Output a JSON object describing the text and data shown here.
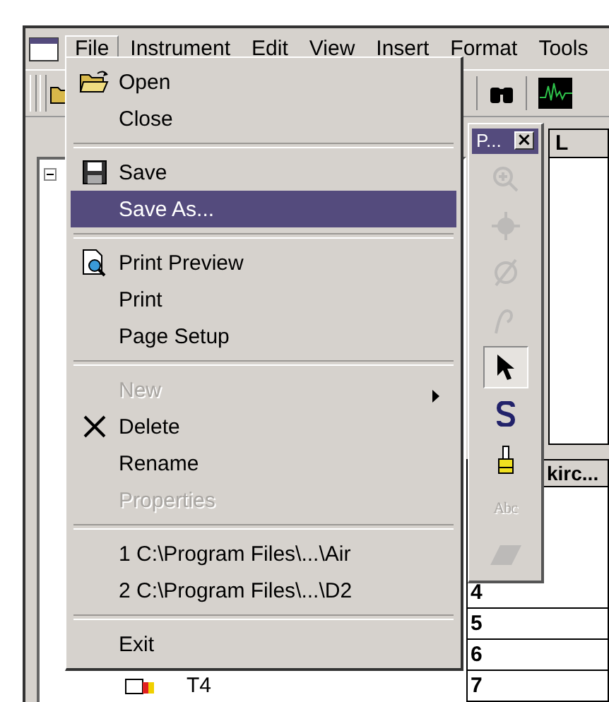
{
  "menu_bar": [
    {
      "label": "File",
      "selected": true
    },
    {
      "label": "Instrument",
      "selected": false
    },
    {
      "label": "Edit",
      "selected": false
    },
    {
      "label": "View",
      "selected": false
    },
    {
      "label": "Insert",
      "selected": false
    },
    {
      "label": "Format",
      "selected": false
    },
    {
      "label": "Tools",
      "selected": false
    }
  ],
  "file_menu": [
    {
      "kind": "folder",
      "label": "Open",
      "disabled": false,
      "selected": false,
      "submenu": false
    },
    {
      "kind": "plain",
      "label": "Close",
      "disabled": false,
      "selected": false,
      "submenu": false
    },
    {
      "kind": "separator"
    },
    {
      "kind": "floppy",
      "label": "Save",
      "disabled": false,
      "selected": false,
      "submenu": false
    },
    {
      "kind": "plain",
      "label": "Save As...",
      "disabled": false,
      "selected": true,
      "submenu": false
    },
    {
      "kind": "separator"
    },
    {
      "kind": "preview",
      "label": "Print Preview",
      "disabled": false,
      "selected": false,
      "submenu": false
    },
    {
      "kind": "plain",
      "label": "Print",
      "disabled": false,
      "selected": false,
      "submenu": false
    },
    {
      "kind": "plain",
      "label": "Page Setup",
      "disabled": false,
      "selected": false,
      "submenu": false
    },
    {
      "kind": "separator"
    },
    {
      "kind": "plain",
      "label": "New",
      "disabled": true,
      "selected": false,
      "submenu": true
    },
    {
      "kind": "cross",
      "label": "Delete",
      "disabled": false,
      "selected": false,
      "submenu": false
    },
    {
      "kind": "plain",
      "label": "Rename",
      "disabled": false,
      "selected": false,
      "submenu": false
    },
    {
      "kind": "plain",
      "label": "Properties",
      "disabled": true,
      "selected": false,
      "submenu": false
    },
    {
      "kind": "separator"
    },
    {
      "kind": "plain",
      "label": "1 C:\\Program Files\\...\\Air",
      "disabled": false,
      "selected": false,
      "submenu": false
    },
    {
      "kind": "plain",
      "label": "2 C:\\Program Files\\...\\D2",
      "disabled": false,
      "selected": false,
      "submenu": false
    },
    {
      "kind": "separator"
    },
    {
      "kind": "plain",
      "label": "Exit",
      "disabled": false,
      "selected": false,
      "submenu": false
    }
  ],
  "palette": {
    "title": "P...",
    "close": "×",
    "tools": [
      {
        "kind": "zoom",
        "disabled": true,
        "selected": false
      },
      {
        "kind": "crosshair",
        "disabled": true,
        "selected": false
      },
      {
        "kind": "empty-set",
        "disabled": true,
        "selected": false
      },
      {
        "kind": "curve",
        "disabled": true,
        "selected": false
      },
      {
        "kind": "pointer",
        "disabled": false,
        "selected": true
      },
      {
        "kind": "s-tool",
        "disabled": false,
        "selected": false
      },
      {
        "kind": "brush",
        "disabled": false,
        "selected": false
      },
      {
        "kind": "text",
        "label": "Abc",
        "disabled": true,
        "selected": false
      },
      {
        "kind": "eraser",
        "disabled": true,
        "selected": false
      }
    ]
  },
  "tree": {
    "items": [
      {
        "label": "T4"
      }
    ]
  },
  "upper_panel": {
    "column_header": "L"
  },
  "table": {
    "column_header": "kirc...",
    "rows": [
      "4",
      "5",
      "6",
      "7"
    ]
  }
}
